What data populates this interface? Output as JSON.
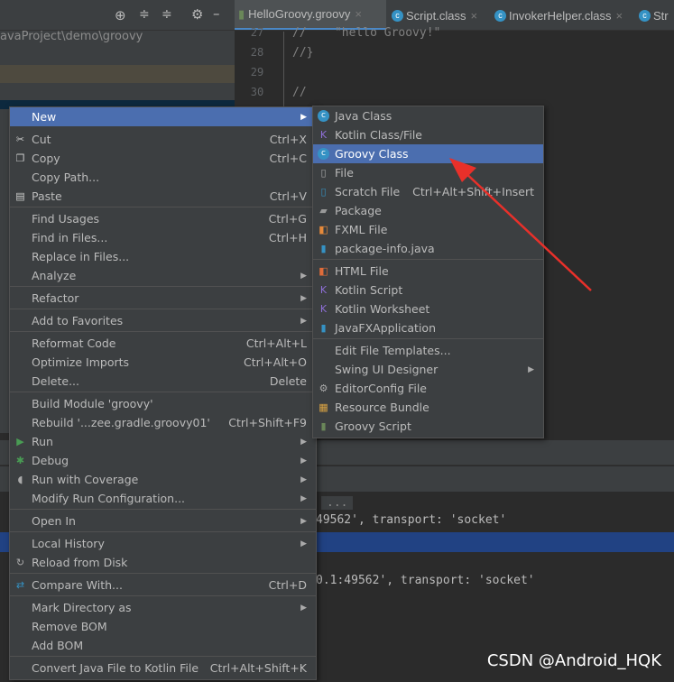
{
  "project": {
    "path": "avaProject\\demo\\groovy",
    "toolbar_icons": [
      "locate-icon",
      "expand-all-icon",
      "collapse-all-icon",
      "gear-icon",
      "minimize-icon"
    ]
  },
  "tabs": [
    {
      "label": "HelloGroovy.groovy",
      "active": true
    },
    {
      "label": "Script.class"
    },
    {
      "label": "InvokerHelper.class"
    },
    {
      "label": "Str"
    }
  ],
  "editor": {
    "lines": [
      {
        "n": "27",
        "code": "//    \"hello Groovy!\""
      },
      {
        "n": "28",
        "code": "//}"
      },
      {
        "n": "29",
        "code": ""
      },
      {
        "n": "30",
        "code": "//"
      }
    ]
  },
  "console": {
    "lines": [
      "...",
      "49562', transport: 'socket'",
      "0.1:49562', transport: 'socket'"
    ]
  },
  "context_menu": {
    "items": [
      {
        "label": "New",
        "arrow": true,
        "highlight": true
      },
      {
        "label": "Cut",
        "shortcut": "Ctrl+X",
        "icon": "scissors-icon",
        "gap": true
      },
      {
        "label": "Copy",
        "shortcut": "Ctrl+C",
        "icon": "copy-icon"
      },
      {
        "label": "Copy Path...",
        "shortcut": ""
      },
      {
        "label": "Paste",
        "shortcut": "Ctrl+V",
        "icon": "paste-icon"
      },
      {
        "sep": true
      },
      {
        "label": "Find Usages",
        "shortcut": "Ctrl+G"
      },
      {
        "label": "Find in Files...",
        "shortcut": "Ctrl+H"
      },
      {
        "label": "Replace in Files..."
      },
      {
        "label": "Analyze",
        "arrow": true
      },
      {
        "sep": true
      },
      {
        "label": "Refactor",
        "arrow": true
      },
      {
        "sep": true
      },
      {
        "label": "Add to Favorites",
        "arrow": true
      },
      {
        "sep": true
      },
      {
        "label": "Reformat Code",
        "shortcut": "Ctrl+Alt+L"
      },
      {
        "label": "Optimize Imports",
        "shortcut": "Ctrl+Alt+O"
      },
      {
        "label": "Delete...",
        "shortcut": "Delete"
      },
      {
        "sep": true
      },
      {
        "label": "Build Module 'groovy'"
      },
      {
        "label": "Rebuild '...zee.gradle.groovy01'",
        "shortcut": "Ctrl+Shift+F9"
      },
      {
        "label": "Run",
        "arrow": true,
        "icon": "run-icon"
      },
      {
        "label": "Debug",
        "arrow": true,
        "icon": "debug-icon"
      },
      {
        "label": "Run with Coverage",
        "arrow": true,
        "icon": "coverage-icon"
      },
      {
        "label": "Modify Run Configuration...",
        "arrow": true
      },
      {
        "sep": true
      },
      {
        "label": "Open In",
        "arrow": true
      },
      {
        "sep": true
      },
      {
        "label": "Local History",
        "arrow": true
      },
      {
        "label": "Reload from Disk",
        "icon": "reload-icon"
      },
      {
        "sep": true
      },
      {
        "label": "Compare With...",
        "shortcut": "Ctrl+D",
        "icon": "compare-icon"
      },
      {
        "sep": true
      },
      {
        "label": "Mark Directory as",
        "arrow": true
      },
      {
        "label": "Remove BOM"
      },
      {
        "label": "Add BOM"
      },
      {
        "sep": true
      },
      {
        "label": "Convert Java File to Kotlin File",
        "shortcut": "Ctrl+Alt+Shift+K"
      }
    ]
  },
  "submenu": {
    "items": [
      {
        "label": "Java Class",
        "icon": "java-class-icon"
      },
      {
        "label": "Kotlin Class/File",
        "icon": "kotlin-file-icon"
      },
      {
        "label": "Groovy Class",
        "icon": "groovy-class-icon",
        "highlight": true
      },
      {
        "label": "File",
        "icon": "file-icon"
      },
      {
        "label": "Scratch File",
        "shortcut": "Ctrl+Alt+Shift+Insert",
        "icon": "scratch-file-icon"
      },
      {
        "label": "Package",
        "icon": "package-icon"
      },
      {
        "label": "FXML File",
        "icon": "fxml-icon"
      },
      {
        "label": "package-info.java",
        "icon": "java-file-icon"
      },
      {
        "sep": true
      },
      {
        "label": "HTML File",
        "icon": "html-icon"
      },
      {
        "label": "Kotlin Script",
        "icon": "kotlin-script-icon"
      },
      {
        "label": "Kotlin Worksheet",
        "icon": "kotlin-worksheet-icon"
      },
      {
        "label": "JavaFXApplication",
        "icon": "javafx-icon"
      },
      {
        "sep": true
      },
      {
        "label": "Edit File Templates..."
      },
      {
        "label": "Swing UI Designer",
        "arrow": true
      },
      {
        "label": "EditorConfig File",
        "icon": "gear-icon"
      },
      {
        "label": "Resource Bundle",
        "icon": "resource-bundle-icon"
      },
      {
        "label": "Groovy Script",
        "icon": "groovy-script-icon"
      }
    ]
  },
  "watermark": "CSDN @Android_HQK",
  "colors": {
    "highlight": "#4b6eaf",
    "arrow": "#e8302a"
  }
}
